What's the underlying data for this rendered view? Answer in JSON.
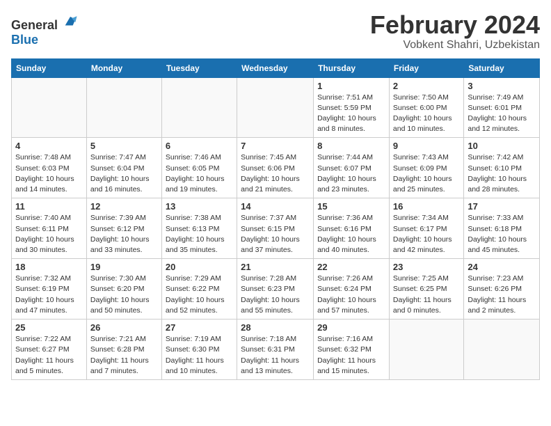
{
  "header": {
    "logo_general": "General",
    "logo_blue": "Blue",
    "title": "February 2024",
    "subtitle": "Vobkent Shahri, Uzbekistan"
  },
  "weekdays": [
    "Sunday",
    "Monday",
    "Tuesday",
    "Wednesday",
    "Thursday",
    "Friday",
    "Saturday"
  ],
  "weeks": [
    [
      {
        "day": "",
        "info": ""
      },
      {
        "day": "",
        "info": ""
      },
      {
        "day": "",
        "info": ""
      },
      {
        "day": "",
        "info": ""
      },
      {
        "day": "1",
        "info": "Sunrise: 7:51 AM\nSunset: 5:59 PM\nDaylight: 10 hours\nand 8 minutes."
      },
      {
        "day": "2",
        "info": "Sunrise: 7:50 AM\nSunset: 6:00 PM\nDaylight: 10 hours\nand 10 minutes."
      },
      {
        "day": "3",
        "info": "Sunrise: 7:49 AM\nSunset: 6:01 PM\nDaylight: 10 hours\nand 12 minutes."
      }
    ],
    [
      {
        "day": "4",
        "info": "Sunrise: 7:48 AM\nSunset: 6:03 PM\nDaylight: 10 hours\nand 14 minutes."
      },
      {
        "day": "5",
        "info": "Sunrise: 7:47 AM\nSunset: 6:04 PM\nDaylight: 10 hours\nand 16 minutes."
      },
      {
        "day": "6",
        "info": "Sunrise: 7:46 AM\nSunset: 6:05 PM\nDaylight: 10 hours\nand 19 minutes."
      },
      {
        "day": "7",
        "info": "Sunrise: 7:45 AM\nSunset: 6:06 PM\nDaylight: 10 hours\nand 21 minutes."
      },
      {
        "day": "8",
        "info": "Sunrise: 7:44 AM\nSunset: 6:07 PM\nDaylight: 10 hours\nand 23 minutes."
      },
      {
        "day": "9",
        "info": "Sunrise: 7:43 AM\nSunset: 6:09 PM\nDaylight: 10 hours\nand 25 minutes."
      },
      {
        "day": "10",
        "info": "Sunrise: 7:42 AM\nSunset: 6:10 PM\nDaylight: 10 hours\nand 28 minutes."
      }
    ],
    [
      {
        "day": "11",
        "info": "Sunrise: 7:40 AM\nSunset: 6:11 PM\nDaylight: 10 hours\nand 30 minutes."
      },
      {
        "day": "12",
        "info": "Sunrise: 7:39 AM\nSunset: 6:12 PM\nDaylight: 10 hours\nand 33 minutes."
      },
      {
        "day": "13",
        "info": "Sunrise: 7:38 AM\nSunset: 6:13 PM\nDaylight: 10 hours\nand 35 minutes."
      },
      {
        "day": "14",
        "info": "Sunrise: 7:37 AM\nSunset: 6:15 PM\nDaylight: 10 hours\nand 37 minutes."
      },
      {
        "day": "15",
        "info": "Sunrise: 7:36 AM\nSunset: 6:16 PM\nDaylight: 10 hours\nand 40 minutes."
      },
      {
        "day": "16",
        "info": "Sunrise: 7:34 AM\nSunset: 6:17 PM\nDaylight: 10 hours\nand 42 minutes."
      },
      {
        "day": "17",
        "info": "Sunrise: 7:33 AM\nSunset: 6:18 PM\nDaylight: 10 hours\nand 45 minutes."
      }
    ],
    [
      {
        "day": "18",
        "info": "Sunrise: 7:32 AM\nSunset: 6:19 PM\nDaylight: 10 hours\nand 47 minutes."
      },
      {
        "day": "19",
        "info": "Sunrise: 7:30 AM\nSunset: 6:20 PM\nDaylight: 10 hours\nand 50 minutes."
      },
      {
        "day": "20",
        "info": "Sunrise: 7:29 AM\nSunset: 6:22 PM\nDaylight: 10 hours\nand 52 minutes."
      },
      {
        "day": "21",
        "info": "Sunrise: 7:28 AM\nSunset: 6:23 PM\nDaylight: 10 hours\nand 55 minutes."
      },
      {
        "day": "22",
        "info": "Sunrise: 7:26 AM\nSunset: 6:24 PM\nDaylight: 10 hours\nand 57 minutes."
      },
      {
        "day": "23",
        "info": "Sunrise: 7:25 AM\nSunset: 6:25 PM\nDaylight: 11 hours\nand 0 minutes."
      },
      {
        "day": "24",
        "info": "Sunrise: 7:23 AM\nSunset: 6:26 PM\nDaylight: 11 hours\nand 2 minutes."
      }
    ],
    [
      {
        "day": "25",
        "info": "Sunrise: 7:22 AM\nSunset: 6:27 PM\nDaylight: 11 hours\nand 5 minutes."
      },
      {
        "day": "26",
        "info": "Sunrise: 7:21 AM\nSunset: 6:28 PM\nDaylight: 11 hours\nand 7 minutes."
      },
      {
        "day": "27",
        "info": "Sunrise: 7:19 AM\nSunset: 6:30 PM\nDaylight: 11 hours\nand 10 minutes."
      },
      {
        "day": "28",
        "info": "Sunrise: 7:18 AM\nSunset: 6:31 PM\nDaylight: 11 hours\nand 13 minutes."
      },
      {
        "day": "29",
        "info": "Sunrise: 7:16 AM\nSunset: 6:32 PM\nDaylight: 11 hours\nand 15 minutes."
      },
      {
        "day": "",
        "info": ""
      },
      {
        "day": "",
        "info": ""
      }
    ]
  ]
}
